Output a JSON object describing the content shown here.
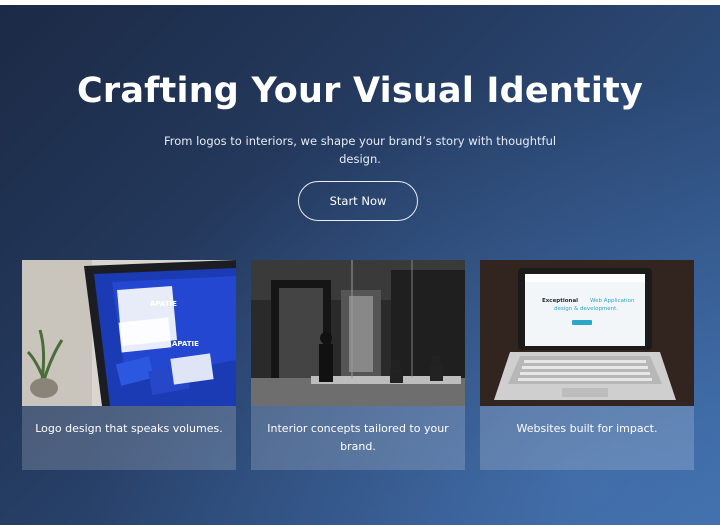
{
  "hero": {
    "title": "Crafting Your Visual Identity",
    "subtitle": "From logos to interiors, we shape your brand’s story with thoughtful design.",
    "cta_label": "Start Now"
  },
  "cards": [
    {
      "caption": "Logo design that speaks volumes.",
      "image": "laptop-with-logo-mockups",
      "brand_text_1": "APATIE",
      "brand_text_2": "APATIE"
    },
    {
      "caption": "Interior concepts tailored to your brand.",
      "image": "office-interior-black-and-white"
    },
    {
      "caption": "Websites built for impact.",
      "image": "laptop-with-website",
      "screen_heading_1": "Exceptional",
      "screen_heading_2": "Web Application",
      "screen_heading_3": "design & development."
    }
  ],
  "colors": {
    "gradient_start": "#1b2a45",
    "gradient_end": "#3b6aa5",
    "text": "#ffffff"
  }
}
